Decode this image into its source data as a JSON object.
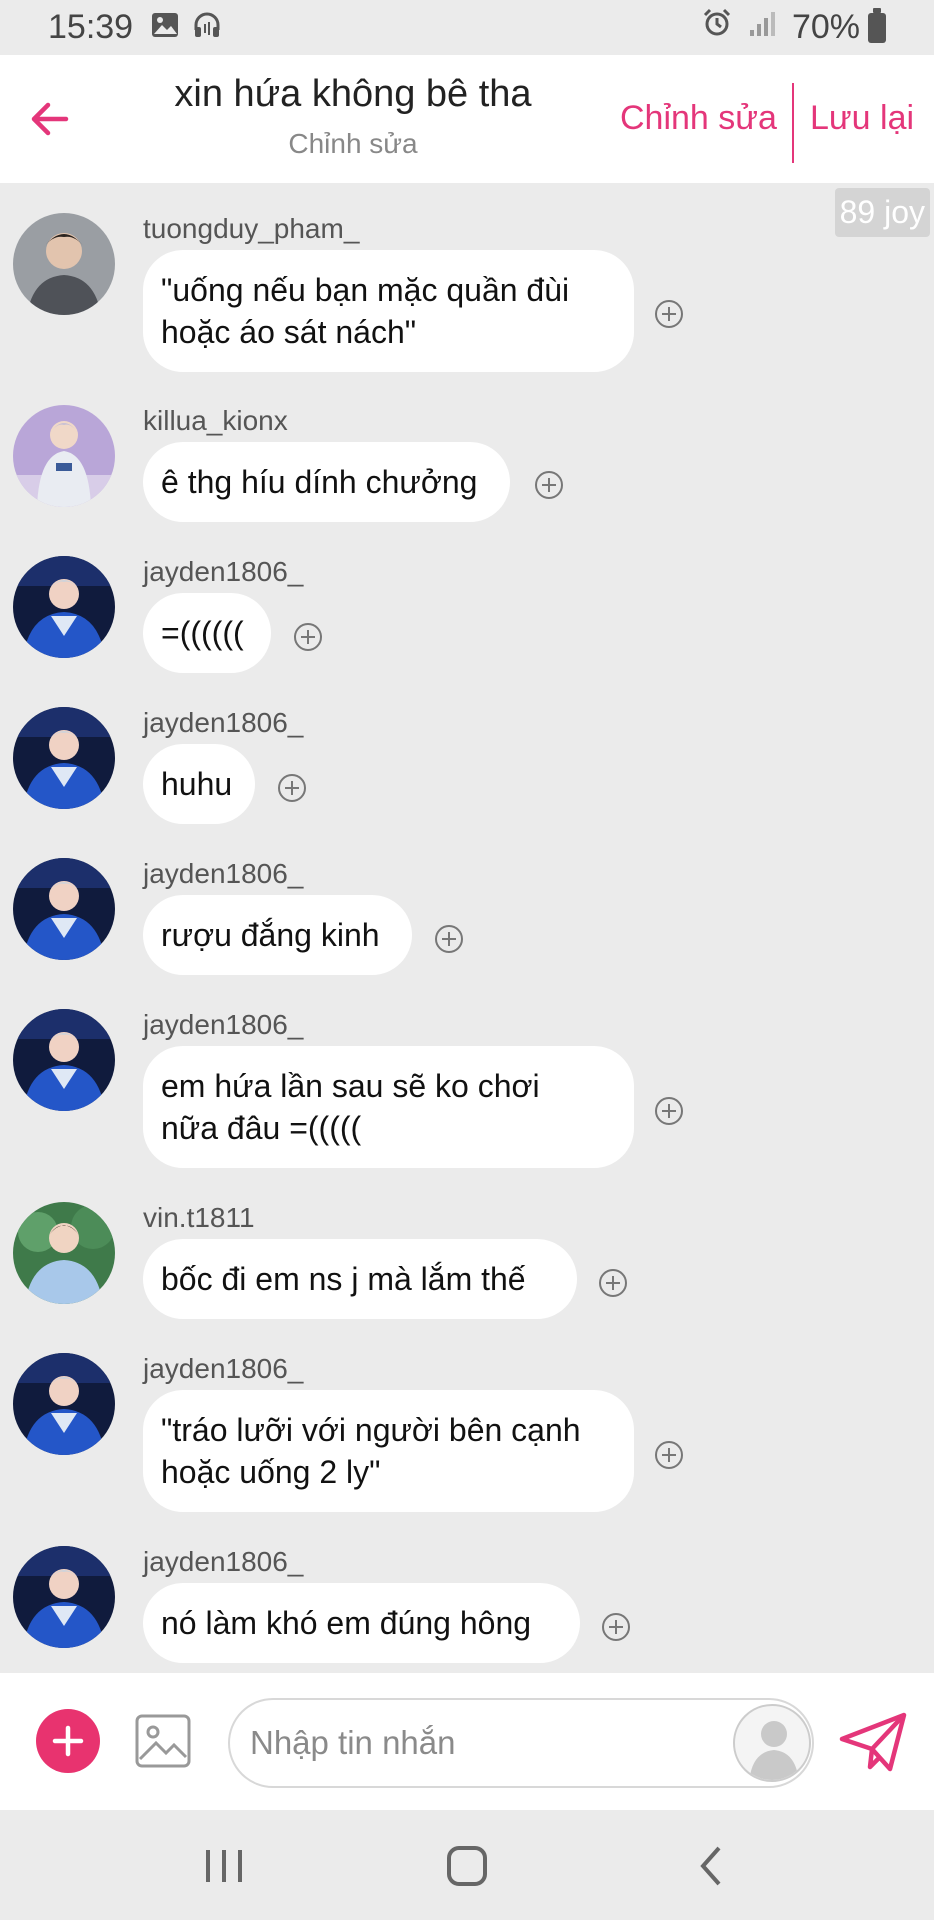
{
  "status_bar": {
    "time": "15:39",
    "battery": "70%",
    "icons": [
      "image-icon",
      "headphones-icon",
      "alarm-icon",
      "signal-icon",
      "battery-icon"
    ]
  },
  "header": {
    "title": "xin hứa không bê tha",
    "subtitle": "Chỉnh sửa",
    "edit_label": "Chỉnh sửa",
    "save_label": "Lưu lại"
  },
  "joy_badge": "89 joy",
  "messages": [
    {
      "sender": "tuongduy_pham_",
      "lines": [
        "\"uống nếu bạn mặc quần đùi",
        "hoặc áo sát nách\""
      ]
    },
    {
      "sender": "killua_kionx",
      "lines": [
        "ê thg híu dính chưởng"
      ]
    },
    {
      "sender": "jayden1806_",
      "lines": [
        "=(((((("
      ]
    },
    {
      "sender": "jayden1806_",
      "lines": [
        "huhu"
      ]
    },
    {
      "sender": "jayden1806_",
      "lines": [
        "rượu đắng kinh"
      ]
    },
    {
      "sender": "jayden1806_",
      "lines": [
        "em hứa lần sau sẽ ko chơi",
        "nữa đâu =((((("
      ]
    },
    {
      "sender": "vin.t1811",
      "lines": [
        "bốc đi em ns j mà lắm thế"
      ]
    },
    {
      "sender": "jayden1806_",
      "lines": [
        "\"tráo lưỡi với người bên cạnh",
        "hoặc uống 2 ly\""
      ]
    },
    {
      "sender": "jayden1806_",
      "lines": [
        "nó làm khó em đúng hông"
      ]
    }
  ],
  "input": {
    "placeholder": "Nhập tin nhắn"
  },
  "colors": {
    "accent": "#e4367a",
    "background": "#ebebeb",
    "bubble": "#ffffff"
  }
}
